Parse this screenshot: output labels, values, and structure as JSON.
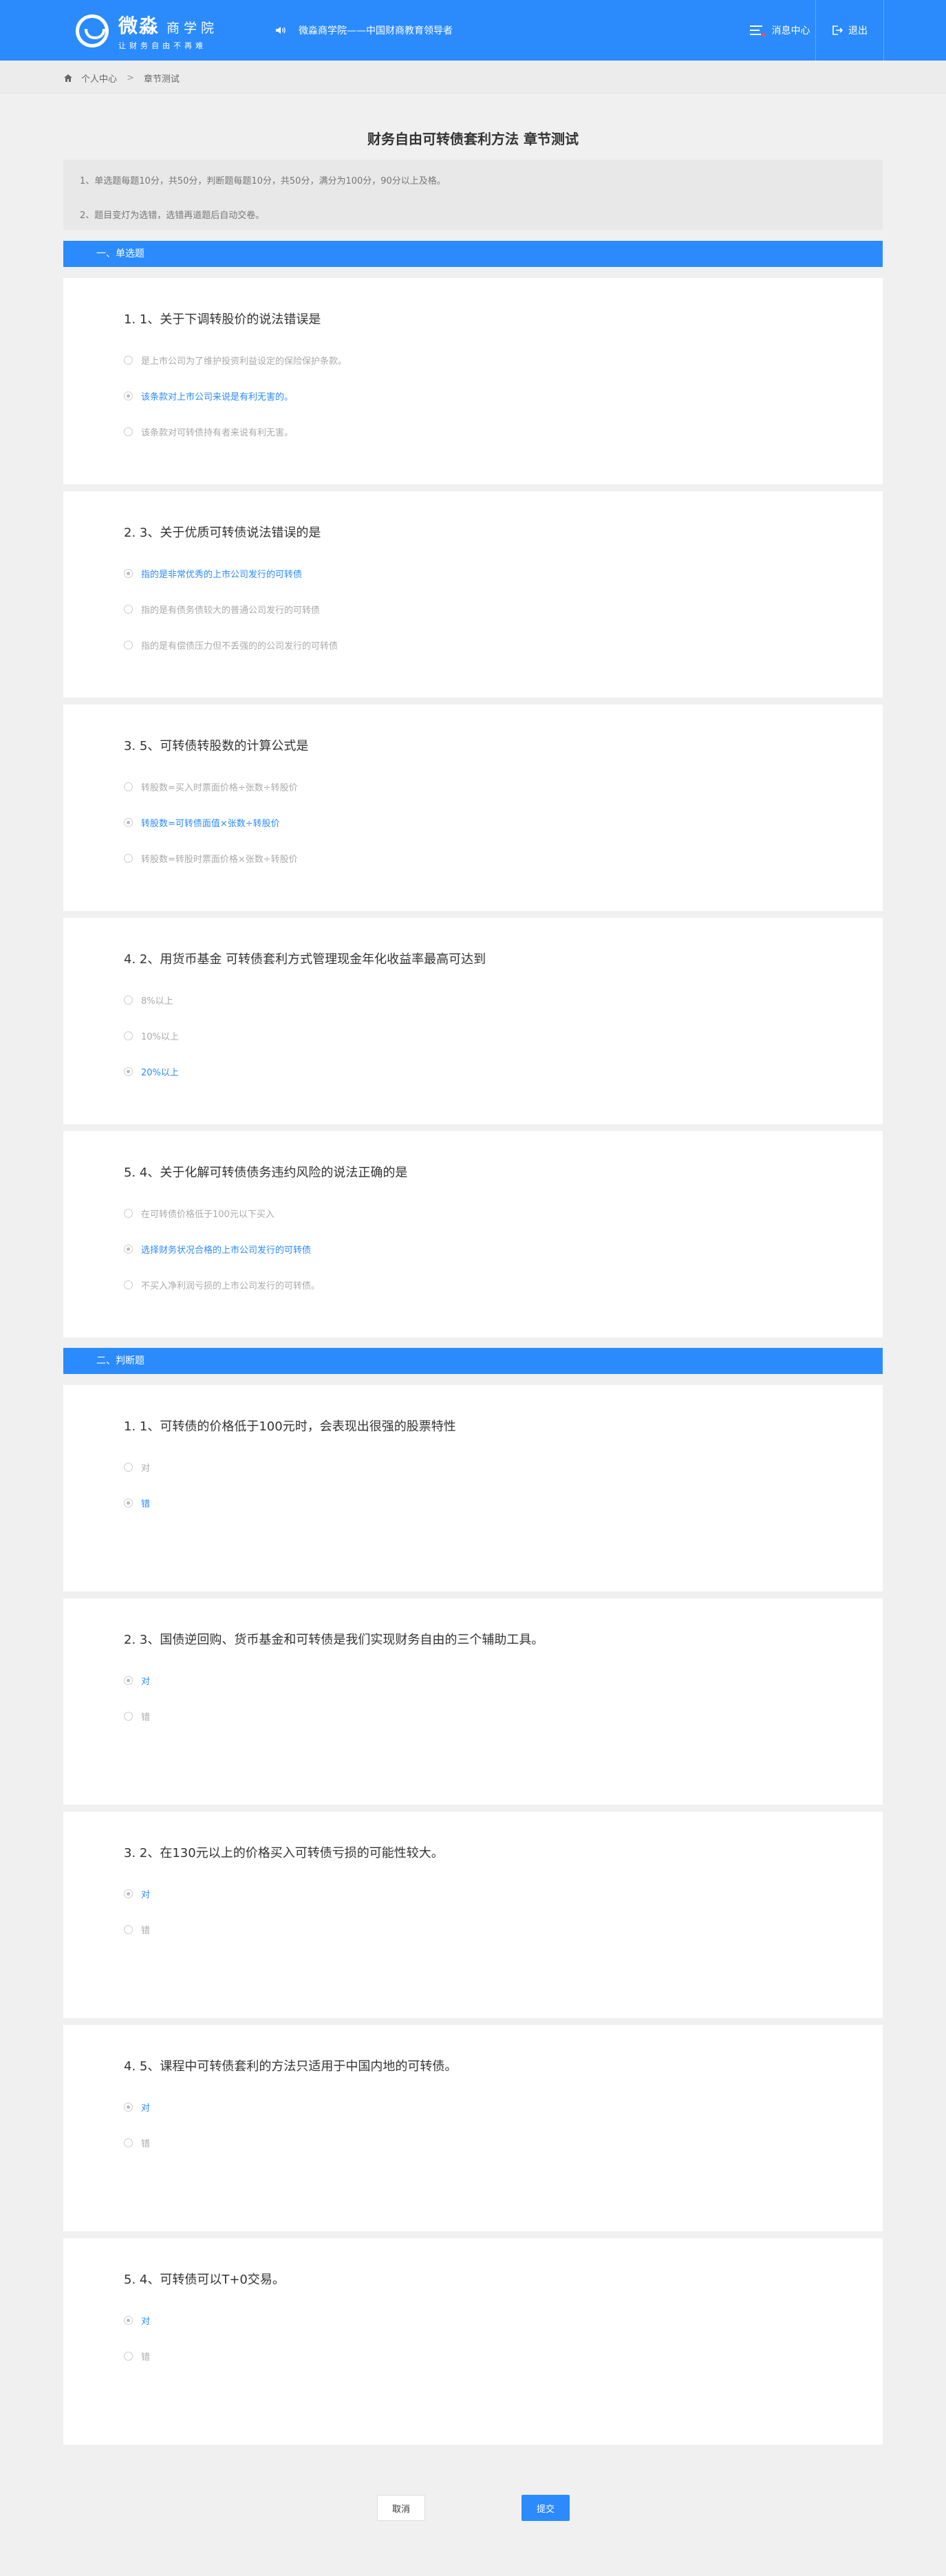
{
  "header": {
    "logo_name": "微淼",
    "logo_sub": "商学院",
    "logo_slogan": "让财务自由不再难",
    "notice": "微淼商学院——中国财商教育领导者",
    "messages_label": "消息中心",
    "logout_label": "退出"
  },
  "breadcrumb": {
    "home": "个人中心",
    "separator": ">",
    "current": "章节测试"
  },
  "page_title": "财务自由可转债套利方法 章节测试",
  "tips": [
    "1、单选题每题10分，共50分，判断题每题10分，共50分，满分为100分，90分以上及格。",
    "2、题目变灯为选错，选错再道题后自动交卷。"
  ],
  "sections": {
    "single": "一、单选题",
    "judge": "二、判断题"
  },
  "single_questions": [
    {
      "title": "1. 1、关于下调转股价的说法错误是",
      "options": [
        "是上市公司为了维护投资利益设定的保险保护条款。",
        "该条款对上市公司来说是有利无害的。",
        "该条款对可转债持有者来说有利无害。"
      ],
      "selected": 1
    },
    {
      "title": "2. 3、关于优质可转债说法错误的是",
      "options": [
        "指的是非常优秀的上市公司发行的可转债",
        "指的是有债务债较大的普通公司发行的可转债",
        "指的是有偿债压力但不丢强的的公司发行的可转债"
      ],
      "selected": 0
    },
    {
      "title": "3. 5、可转债转股数的计算公式是",
      "options": [
        "转股数=买入时票面价格÷张数÷转股价",
        "转股数=可转债面值×张数÷转股价",
        "转股数=转股时票面价格×张数÷转股价"
      ],
      "selected": 1
    },
    {
      "title": "4. 2、用货币基金 可转债套利方式管理现金年化收益率最高可达到",
      "options": [
        "8%以上",
        "10%以上",
        "20%以上"
      ],
      "selected": 2
    },
    {
      "title": "5. 4、关于化解可转债债务违约风险的说法正确的是",
      "options": [
        "在可转债价格低于100元以下买入",
        "选择财务状况合格的上市公司发行的可转债",
        "不买入净利润亏损的上市公司发行的可转债。"
      ],
      "selected": 1
    }
  ],
  "judge_questions": [
    {
      "title": "1. 1、可转债的价格低于100元时，会表现出很强的股票特性",
      "options": [
        "对",
        "错"
      ],
      "selected": 1
    },
    {
      "title": "2. 3、国债逆回购、货币基金和可转债是我们实现财务自由的三个辅助工具。",
      "options": [
        "对",
        "错"
      ],
      "selected": 0
    },
    {
      "title": "3. 2、在130元以上的价格买入可转债亏损的可能性较大。",
      "options": [
        "对",
        "错"
      ],
      "selected": 0
    },
    {
      "title": "4. 5、课程中可转债套利的方法只适用于中国内地的可转债。",
      "options": [
        "对",
        "错"
      ],
      "selected": 0
    },
    {
      "title": "5. 4、可转债可以T+0交易。",
      "options": [
        "对",
        "错"
      ],
      "selected": 0
    }
  ],
  "buttons": {
    "cancel": "取消",
    "submit": "提交"
  },
  "colors": {
    "primary": "#2b8bfc",
    "background": "#f0f0f0",
    "badge": "#ff4b4b"
  }
}
